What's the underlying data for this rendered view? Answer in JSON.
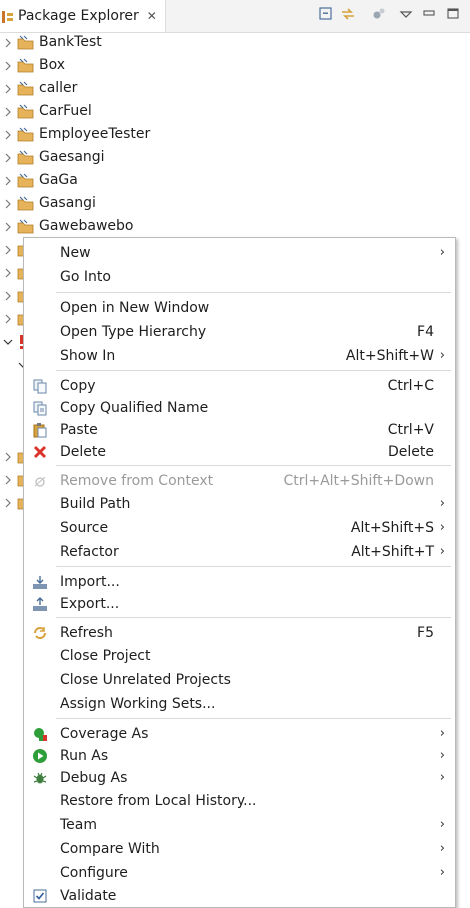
{
  "view": {
    "title": "Package Explorer",
    "close_glyph": "✕",
    "toolbar_icons": [
      "collapse-all-icon",
      "link-with-editor-icon",
      "view-settings-icon",
      "view-menu-icon",
      "minimize-icon",
      "maximize-icon"
    ]
  },
  "tree": {
    "items": [
      {
        "label": "BankTest"
      },
      {
        "label": "Box"
      },
      {
        "label": "caller"
      },
      {
        "label": "CarFuel"
      },
      {
        "label": "EmployeeTester"
      },
      {
        "label": "Gaesangi"
      },
      {
        "label": "GaGa"
      },
      {
        "label": "Gasangi"
      },
      {
        "label": "Gawebawebo"
      }
    ]
  },
  "context_menu": {
    "new": {
      "label": "New",
      "arrow": "›"
    },
    "go_into": {
      "label": "Go Into"
    },
    "open_new_window": {
      "label": "Open in New Window"
    },
    "open_type_hierarchy": {
      "label": "Open Type Hierarchy",
      "shortcut": "F4"
    },
    "show_in": {
      "label": "Show In",
      "shortcut": "Alt+Shift+W",
      "arrow": "›"
    },
    "copy": {
      "label": "Copy",
      "shortcut": "Ctrl+C"
    },
    "copy_qualified": {
      "label": "Copy Qualified Name"
    },
    "paste": {
      "label": "Paste",
      "shortcut": "Ctrl+V"
    },
    "delete": {
      "label": "Delete",
      "shortcut": "Delete"
    },
    "remove_context": {
      "label": "Remove from Context",
      "shortcut": "Ctrl+Alt+Shift+Down"
    },
    "build_path": {
      "label": "Build Path",
      "arrow": "›"
    },
    "source": {
      "label": "Source",
      "shortcut": "Alt+Shift+S",
      "arrow": "›"
    },
    "refactor": {
      "label": "Refactor",
      "shortcut": "Alt+Shift+T",
      "arrow": "›"
    },
    "import": {
      "label": "Import..."
    },
    "export": {
      "label": "Export..."
    },
    "refresh": {
      "label": "Refresh",
      "shortcut": "F5"
    },
    "close_project": {
      "label": "Close Project"
    },
    "close_unrelated": {
      "label": "Close Unrelated Projects"
    },
    "assign_working_sets": {
      "label": "Assign Working Sets..."
    },
    "coverage_as": {
      "label": "Coverage As",
      "arrow": "›"
    },
    "run_as": {
      "label": "Run As",
      "arrow": "›"
    },
    "debug_as": {
      "label": "Debug As",
      "arrow": "›"
    },
    "restore_history": {
      "label": "Restore from Local History..."
    },
    "team": {
      "label": "Team",
      "arrow": "›"
    },
    "compare_with": {
      "label": "Compare With",
      "arrow": "›"
    },
    "configure": {
      "label": "Configure",
      "arrow": "›"
    },
    "validate": {
      "label": "Validate"
    }
  },
  "colors": {
    "accent_delete": "#d9342b",
    "run_green": "#2e9e3a",
    "project_folder": "#d8a23c",
    "error_red": "#d9342b"
  }
}
